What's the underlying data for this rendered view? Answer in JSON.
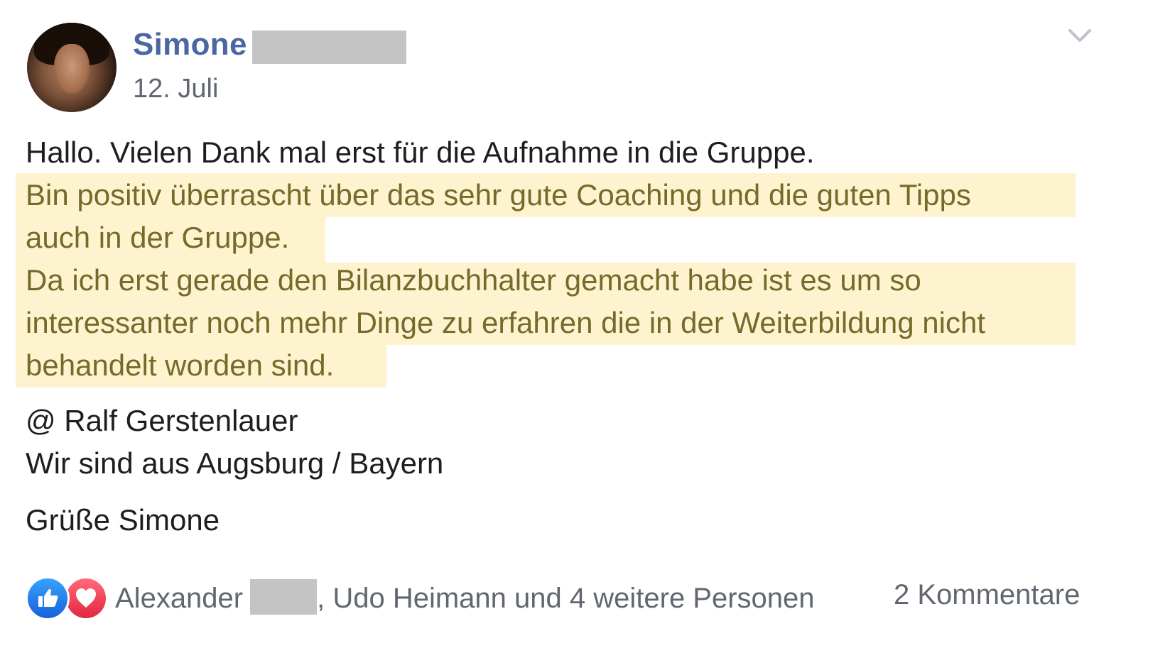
{
  "author": {
    "first_name": "Simone",
    "date": "12. Juli"
  },
  "post": {
    "line1": "Hallo. Vielen Dank mal erst für die Aufnahme in die Gruppe.",
    "line2": "Bin positiv überrascht über das sehr gute Coaching und die guten Tipps",
    "line3": "auch in der Gruppe.",
    "line4": "Da ich erst gerade den Bilanzbuchhalter gemacht habe ist es um so",
    "line5": "interessanter noch mehr Dinge zu erfahren die in der Weiterbildung nicht",
    "line6": "behandelt worden sind.",
    "line7": "@ Ralf Gerstenlauer",
    "line8": "Wir sind aus Augsburg / Bayern",
    "line9": "Grüße Simone"
  },
  "footer": {
    "reactor_first": "Alexander",
    "reactor_rest": ", Udo Heimann und 4 weitere Personen",
    "comments": "2 Kommentare"
  },
  "colors": {
    "name_blue": "#4b67a1",
    "highlight_bg": "#fdf4cf",
    "highlight_text": "#76692a",
    "meta_gray": "#616770"
  },
  "icons": [
    "chevron-down-icon",
    "like-reaction-icon",
    "love-reaction-icon"
  ]
}
